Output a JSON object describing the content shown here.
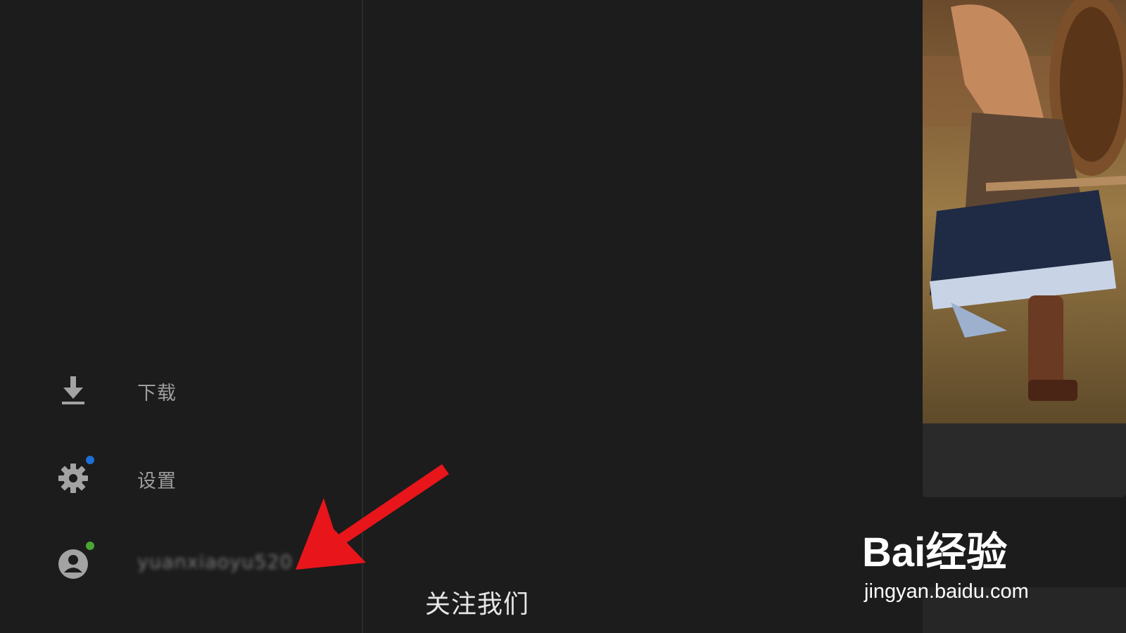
{
  "sidebar": {
    "items": [
      {
        "label": "下载",
        "icon": "download-icon"
      },
      {
        "label": "设置",
        "icon": "gear-icon",
        "badge_color": "#1e6fd6"
      },
      {
        "label": "yuanxiaoyu520",
        "icon": "user-icon",
        "badge_color": "#49a632"
      }
    ]
  },
  "main": {
    "follow_label": "关注我们"
  },
  "watermark": {
    "brand": "Bai经验",
    "url": "jingyan.baidu.com"
  },
  "colors": {
    "background": "#1c1c1c",
    "arrow": "#e8151b"
  }
}
